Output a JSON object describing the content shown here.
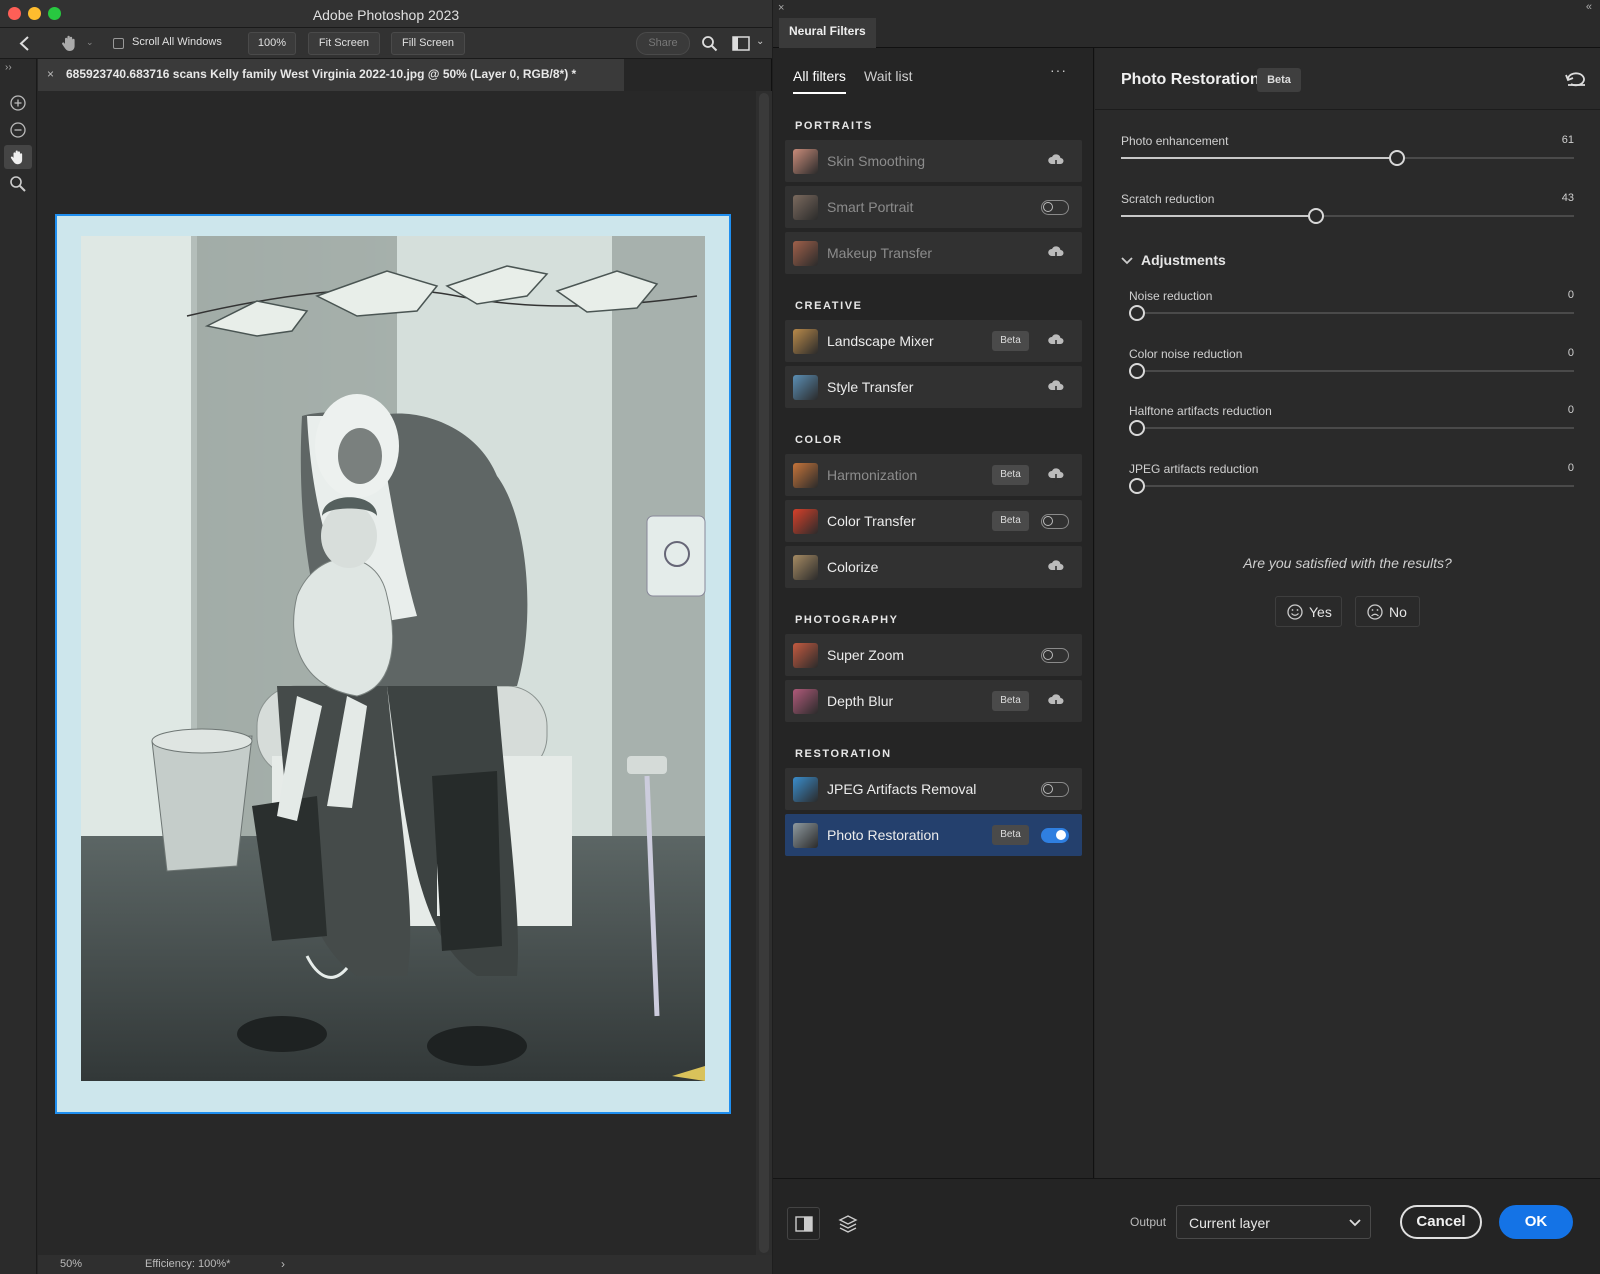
{
  "window": {
    "title": "Adobe Photoshop 2023"
  },
  "options_bar": {
    "scroll_all_label": "Scroll All Windows",
    "zoom_label": "100%",
    "fit_screen_label": "Fit Screen",
    "fill_screen_label": "Fill Screen",
    "share_label": "Share"
  },
  "tools": [
    "zoom-in-icon",
    "zoom-out-icon",
    "hand-icon",
    "magnify-icon"
  ],
  "document": {
    "tab_title": "685923740.683716 scans Kelly family West Virginia 2022-10.jpg @ 50% (Layer 0, RGB/8*) *",
    "close_glyph": "×"
  },
  "status_bar": {
    "zoom": "50%",
    "efficiency": "Efficiency: 100%*",
    "arrow": "›"
  },
  "neural_filters": {
    "panel_tab": "Neural Filters",
    "close_glyph": "×",
    "collapse_glyph": "«",
    "tabs": [
      "All filters",
      "Wait list"
    ],
    "more_glyph": "···",
    "categories": [
      {
        "name": "PORTRAITS",
        "filters": [
          {
            "name": "Skin Smoothing",
            "state": "cloud",
            "enabled": false,
            "beta": false
          },
          {
            "name": "Smart Portrait",
            "state": "toggle-off",
            "enabled": false,
            "beta": false
          },
          {
            "name": "Makeup Transfer",
            "state": "cloud",
            "enabled": false,
            "beta": false
          }
        ]
      },
      {
        "name": "CREATIVE",
        "filters": [
          {
            "name": "Landscape Mixer",
            "state": "cloud",
            "enabled": true,
            "beta": true
          },
          {
            "name": "Style Transfer",
            "state": "cloud",
            "enabled": true,
            "beta": false
          }
        ]
      },
      {
        "name": "COLOR",
        "filters": [
          {
            "name": "Harmonization",
            "state": "cloud",
            "enabled": false,
            "beta": true
          },
          {
            "name": "Color Transfer",
            "state": "toggle-off",
            "enabled": true,
            "beta": true
          },
          {
            "name": "Colorize",
            "state": "cloud",
            "enabled": true,
            "beta": false
          }
        ]
      },
      {
        "name": "PHOTOGRAPHY",
        "filters": [
          {
            "name": "Super Zoom",
            "state": "toggle-off",
            "enabled": true,
            "beta": false
          },
          {
            "name": "Depth Blur",
            "state": "cloud",
            "enabled": true,
            "beta": true
          }
        ]
      },
      {
        "name": "RESTORATION",
        "filters": [
          {
            "name": "JPEG Artifacts Removal",
            "state": "toggle-off",
            "enabled": true,
            "beta": false
          },
          {
            "name": "Photo Restoration",
            "state": "toggle-on",
            "enabled": true,
            "beta": true,
            "selected": true
          }
        ]
      }
    ],
    "beta_label": "Beta",
    "detail": {
      "title": "Photo Restoration",
      "badge": "Beta",
      "sliders": [
        {
          "label": "Photo enhancement",
          "value": 61
        },
        {
          "label": "Scratch reduction",
          "value": 43
        }
      ],
      "adjustments_label": "Adjustments",
      "adjustments": [
        {
          "label": "Noise reduction",
          "value": 0
        },
        {
          "label": "Color noise reduction",
          "value": 0
        },
        {
          "label": "Halftone artifacts reduction",
          "value": 0
        },
        {
          "label": "JPEG artifacts reduction",
          "value": 0
        }
      ],
      "feedback_question": "Are you satisfied with the results?",
      "yes_label": "Yes",
      "no_label": "No"
    },
    "footer": {
      "output_label": "Output",
      "output_value": "Current layer",
      "cancel_label": "Cancel",
      "ok_label": "OK"
    }
  },
  "colors": {
    "accent": "#1473e6",
    "selected_row": "#24406d",
    "canvas_border": "#1f8ff0"
  }
}
